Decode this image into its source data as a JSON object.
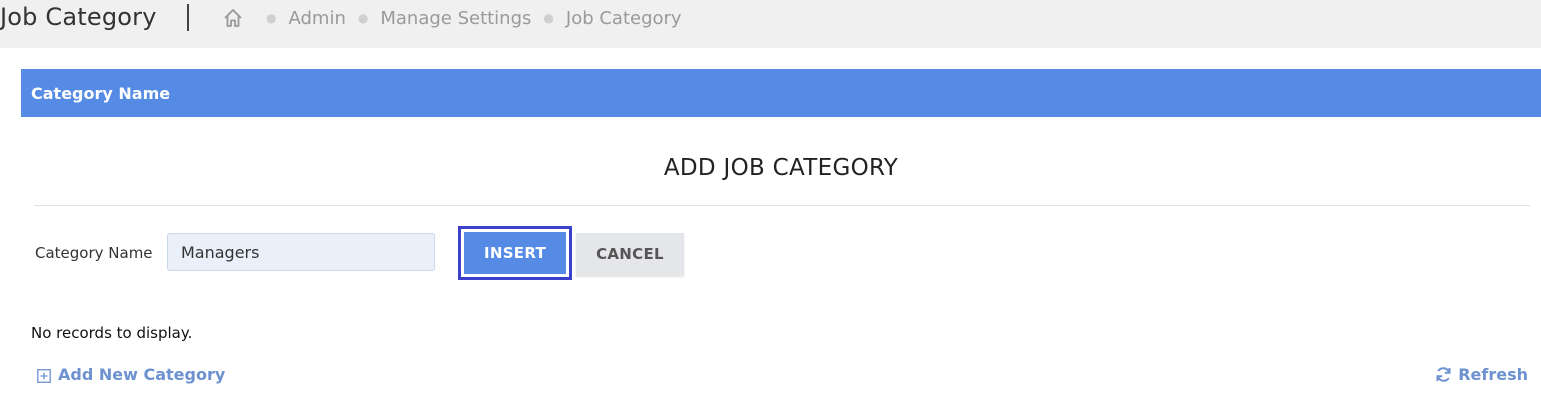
{
  "header": {
    "title": "Job Category",
    "breadcrumb": [
      "Admin",
      "Manage Settings",
      "Job Category"
    ]
  },
  "grid": {
    "column_header": "Category Name"
  },
  "form": {
    "title": "ADD JOB CATEGORY",
    "field_label": "Category Name",
    "field_value": "Managers",
    "insert_label": "INSERT",
    "cancel_label": "CANCEL"
  },
  "grid_footer": {
    "empty_text": "No records to display.",
    "add_label": "Add New Category",
    "refresh_label": "Refresh"
  },
  "icons": {
    "home": "home-icon",
    "add": "plus-square-icon",
    "refresh": "refresh-icon"
  },
  "colors": {
    "accent": "#558be5",
    "focus_outline": "#3b42c9",
    "link": "#6d92cf"
  }
}
